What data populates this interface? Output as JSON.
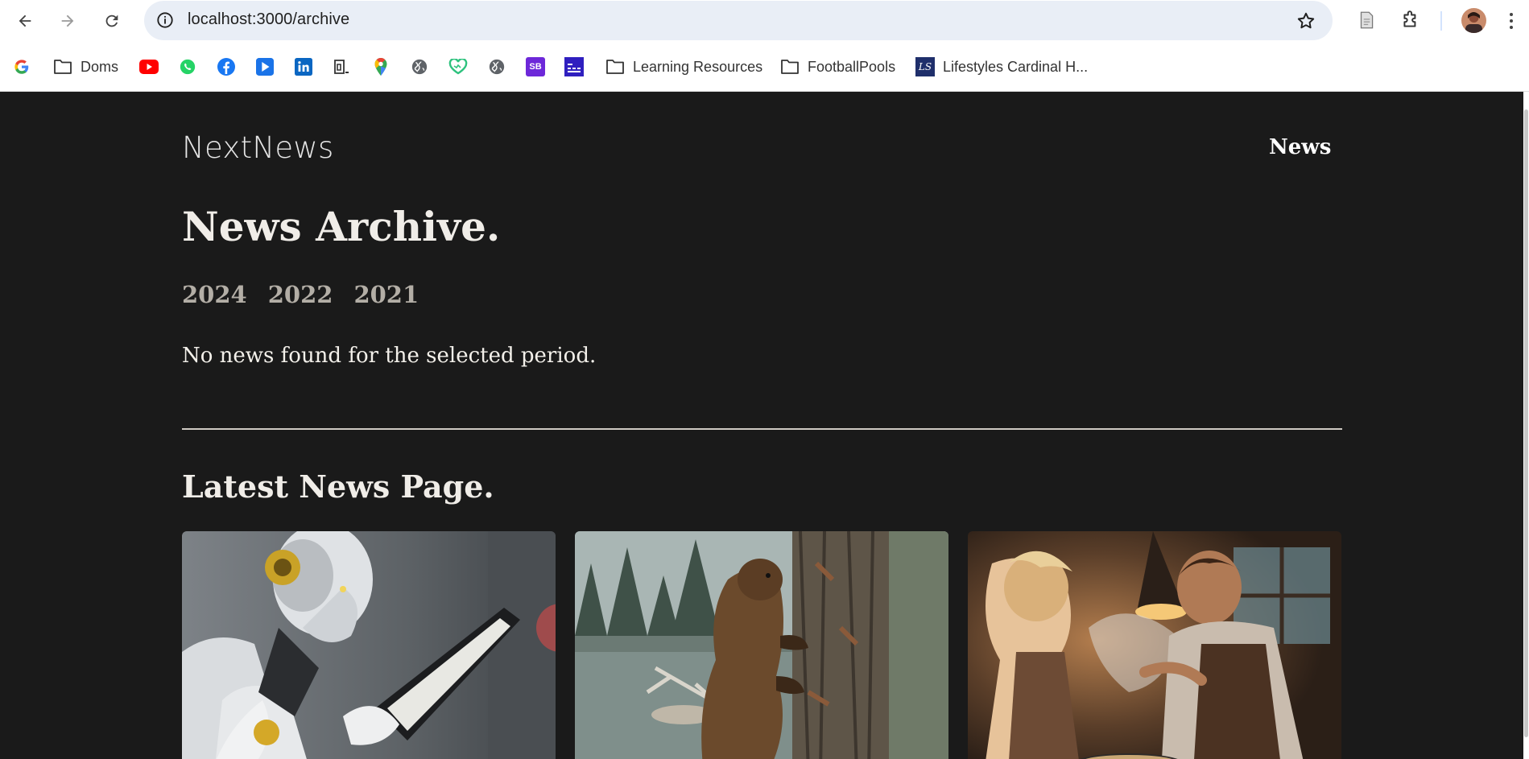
{
  "browser": {
    "url": "localhost:3000/archive",
    "bookmarks": [
      {
        "icon": "google-icon",
        "label": ""
      },
      {
        "icon": "folder-icon",
        "label": "Doms"
      },
      {
        "icon": "youtube-icon",
        "label": ""
      },
      {
        "icon": "whatsapp-icon",
        "label": ""
      },
      {
        "icon": "facebook-icon",
        "label": ""
      },
      {
        "icon": "play-icon",
        "label": ""
      },
      {
        "icon": "linkedin-icon",
        "label": ""
      },
      {
        "icon": "doc-icon",
        "label": ""
      },
      {
        "icon": "maps-pin-icon",
        "label": ""
      },
      {
        "icon": "globe-icon",
        "label": ""
      },
      {
        "icon": "heart-icon",
        "label": ""
      },
      {
        "icon": "globe-icon",
        "label": ""
      },
      {
        "icon": "sb-icon",
        "label": ""
      },
      {
        "icon": "bars-icon",
        "label": ""
      },
      {
        "icon": "folder-icon",
        "label": "Learning Resources"
      },
      {
        "icon": "folder-icon",
        "label": "FootballPools"
      },
      {
        "icon": "ls-icon",
        "label": "Lifestyles Cardinal H..."
      }
    ],
    "sb_text": "SB",
    "ls_text": "LS"
  },
  "site": {
    "logo": "NextNews",
    "nav_news": "News"
  },
  "archive": {
    "title": "News Archive.",
    "years": [
      "2024",
      "2022",
      "2021"
    ],
    "empty_message": "No news found for the selected period."
  },
  "latest": {
    "title": "Latest News Page.",
    "cards": [
      {
        "image": "robot-reading-tablet"
      },
      {
        "image": "beaver-on-tree"
      },
      {
        "image": "couple-cooking"
      }
    ]
  }
}
